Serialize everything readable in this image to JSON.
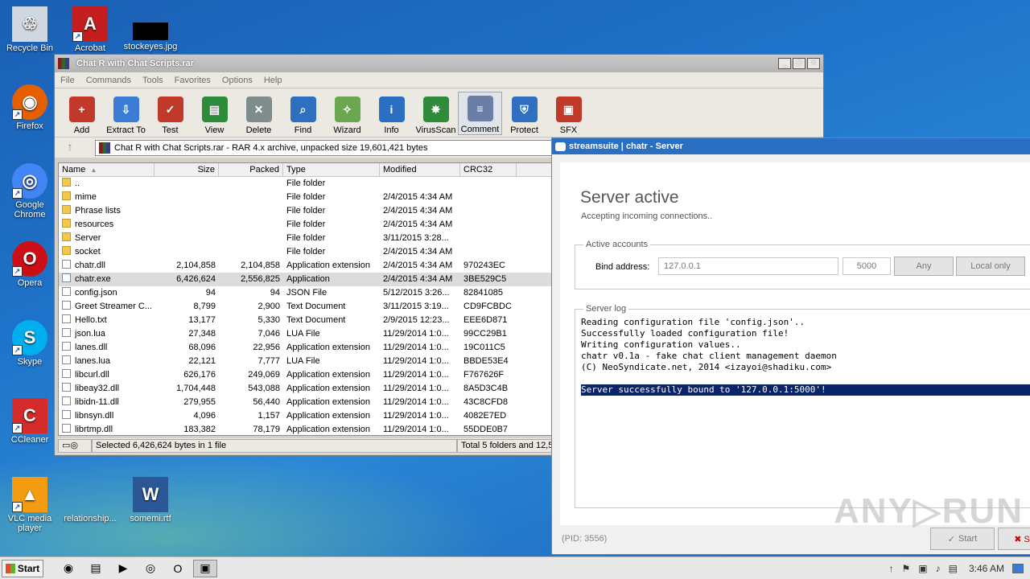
{
  "desktop": {
    "icons": [
      {
        "label": "Recycle Bin",
        "glyph": "♲"
      },
      {
        "label": "Acrobat",
        "glyph": "A"
      },
      {
        "label": "stockeyes.jpg",
        "glyph": ""
      },
      {
        "label": "Firefox",
        "glyph": "◉"
      },
      {
        "label": "Google Chrome",
        "glyph": "◎"
      },
      {
        "label": "Opera",
        "glyph": "O"
      },
      {
        "label": "Skype",
        "glyph": "S"
      },
      {
        "label": "CCleaner",
        "glyph": "C"
      },
      {
        "label": "VLC media player",
        "glyph": "▲"
      },
      {
        "label": "relationship...",
        "glyph": ""
      },
      {
        "label": "somemi.rtf",
        "glyph": "W"
      }
    ],
    "shortcut_arrow": "↗"
  },
  "winrar": {
    "title": "Chat R with Chat Scripts.rar",
    "menu": [
      "File",
      "Commands",
      "Tools",
      "Favorites",
      "Options",
      "Help"
    ],
    "tools": [
      {
        "label": "Add",
        "color": "#c0392b",
        "glyph": "+"
      },
      {
        "label": "Extract To",
        "color": "#3a7bd5",
        "glyph": "⇩"
      },
      {
        "label": "Test",
        "color": "#c0392b",
        "glyph": "✓"
      },
      {
        "label": "View",
        "color": "#2e8b3a",
        "glyph": "▤"
      },
      {
        "label": "Delete",
        "color": "#7f8c8d",
        "glyph": "✕"
      },
      {
        "label": "Find",
        "color": "#2f6fc0",
        "glyph": "⌕"
      },
      {
        "label": "Wizard",
        "color": "#6aa84f",
        "glyph": "✧"
      },
      {
        "label": "Info",
        "color": "#2b6fc2",
        "glyph": "i"
      },
      {
        "label": "VirusScan",
        "color": "#2e8b3a",
        "glyph": "✵"
      },
      {
        "label": "Comment",
        "color": "#6b7fa6",
        "glyph": "≡"
      },
      {
        "label": "Protect",
        "color": "#2f6fc0",
        "glyph": "⛨"
      },
      {
        "label": "SFX",
        "color": "#c0392b",
        "glyph": "▣"
      }
    ],
    "address": "Chat R with Chat Scripts.rar - RAR 4.x archive, unpacked size 19,601,421 bytes",
    "columns": {
      "name": "Name",
      "size": "Size",
      "packed": "Packed",
      "type": "Type",
      "modified": "Modified",
      "crc": "CRC32"
    },
    "rows": [
      {
        "name": "..",
        "size": "",
        "packed": "",
        "type": "File folder",
        "modified": "",
        "crc": "",
        "kind": "folder"
      },
      {
        "name": "mime",
        "size": "",
        "packed": "",
        "type": "File folder",
        "modified": "2/4/2015 4:34 AM",
        "crc": "",
        "kind": "folder"
      },
      {
        "name": "Phrase lists",
        "size": "",
        "packed": "",
        "type": "File folder",
        "modified": "2/4/2015 4:34 AM",
        "crc": "",
        "kind": "folder"
      },
      {
        "name": "resources",
        "size": "",
        "packed": "",
        "type": "File folder",
        "modified": "2/4/2015 4:34 AM",
        "crc": "",
        "kind": "folder"
      },
      {
        "name": "Server",
        "size": "",
        "packed": "",
        "type": "File folder",
        "modified": "3/11/2015 3:28...",
        "crc": "",
        "kind": "folder"
      },
      {
        "name": "socket",
        "size": "",
        "packed": "",
        "type": "File folder",
        "modified": "2/4/2015 4:34 AM",
        "crc": "",
        "kind": "folder"
      },
      {
        "name": "chatr.dll",
        "size": "2,104,858",
        "packed": "2,104,858",
        "type": "Application extension",
        "modified": "2/4/2015 4:34 AM",
        "crc": "970243EC",
        "kind": "file"
      },
      {
        "name": "chatr.exe",
        "size": "6,426,624",
        "packed": "2,556,825",
        "type": "Application",
        "modified": "2/4/2015 4:34 AM",
        "crc": "3BE529C5",
        "kind": "file",
        "selected": true
      },
      {
        "name": "config.json",
        "size": "94",
        "packed": "94",
        "type": "JSON File",
        "modified": "5/12/2015 3:26...",
        "crc": "82841085",
        "kind": "file"
      },
      {
        "name": "Greet Streamer C...",
        "size": "8,799",
        "packed": "2,900",
        "type": "Text Document",
        "modified": "3/11/2015 3:19...",
        "crc": "CD9FCBDC",
        "kind": "file"
      },
      {
        "name": "Hello.txt",
        "size": "13,177",
        "packed": "5,330",
        "type": "Text Document",
        "modified": "2/9/2015 12:23...",
        "crc": "EEE6D871",
        "kind": "file"
      },
      {
        "name": "json.lua",
        "size": "27,348",
        "packed": "7,046",
        "type": "LUA File",
        "modified": "11/29/2014 1:0...",
        "crc": "99CC29B1",
        "kind": "file"
      },
      {
        "name": "lanes.dll",
        "size": "68,096",
        "packed": "22,956",
        "type": "Application extension",
        "modified": "11/29/2014 1:0...",
        "crc": "19C011C5",
        "kind": "file"
      },
      {
        "name": "lanes.lua",
        "size": "22,121",
        "packed": "7,777",
        "type": "LUA File",
        "modified": "11/29/2014 1:0...",
        "crc": "BBDE53E4",
        "kind": "file"
      },
      {
        "name": "libcurl.dll",
        "size": "626,176",
        "packed": "249,069",
        "type": "Application extension",
        "modified": "11/29/2014 1:0...",
        "crc": "F767626F",
        "kind": "file"
      },
      {
        "name": "libeay32.dll",
        "size": "1,704,448",
        "packed": "543,088",
        "type": "Application extension",
        "modified": "11/29/2014 1:0...",
        "crc": "8A5D3C4B",
        "kind": "file"
      },
      {
        "name": "libidn-11.dll",
        "size": "279,955",
        "packed": "56,440",
        "type": "Application extension",
        "modified": "11/29/2014 1:0...",
        "crc": "43C8CFD8",
        "kind": "file"
      },
      {
        "name": "libnsyn.dll",
        "size": "4,096",
        "packed": "1,157",
        "type": "Application extension",
        "modified": "11/29/2014 1:0...",
        "crc": "4082E7ED",
        "kind": "file"
      },
      {
        "name": "librtmp.dll",
        "size": "183,382",
        "packed": "78,179",
        "type": "Application extension",
        "modified": "11/29/2014 1:0...",
        "crc": "55DDE0B7",
        "kind": "file"
      }
    ],
    "status_left": "Selected 6,426,624 bytes in 1 file",
    "status_right": "Total 5 folders and 12,5"
  },
  "chatr": {
    "title": "streamsuite | chatr - Server",
    "heading": "Server active",
    "subheading": "Accepting incoming connections..",
    "accounts_legend": "Active accounts",
    "bind_label": "Bind address:",
    "bind_value": "127.0.0.1",
    "port_value": "5000",
    "any_label": "Any",
    "local_label": "Local only",
    "log_legend": "Server log",
    "log_lines": [
      "Reading configuration file 'config.json'..",
      "Successfully loaded configuration file!",
      "Writing configuration values..",
      "chatr v0.1a - fake chat client management daemon",
      "(C) NeoSyndicate.net, 2014 <izayoi@shadiku.com>"
    ],
    "log_highlight": "Server successfully bound to '127.0.0.1:5000'!",
    "pid": "(PID: 3556)",
    "start_label": "Start",
    "stop_glyph": "✖ S"
  },
  "watermark": "ANY▷RUN",
  "taskbar": {
    "start_label": "Start",
    "apps": [
      "◉",
      "▤",
      "▶",
      "◎",
      "O",
      "▣"
    ],
    "tray_icons": [
      "↑",
      "⚑",
      "▣",
      "♪",
      "▤"
    ],
    "clock": "3:46 AM"
  }
}
